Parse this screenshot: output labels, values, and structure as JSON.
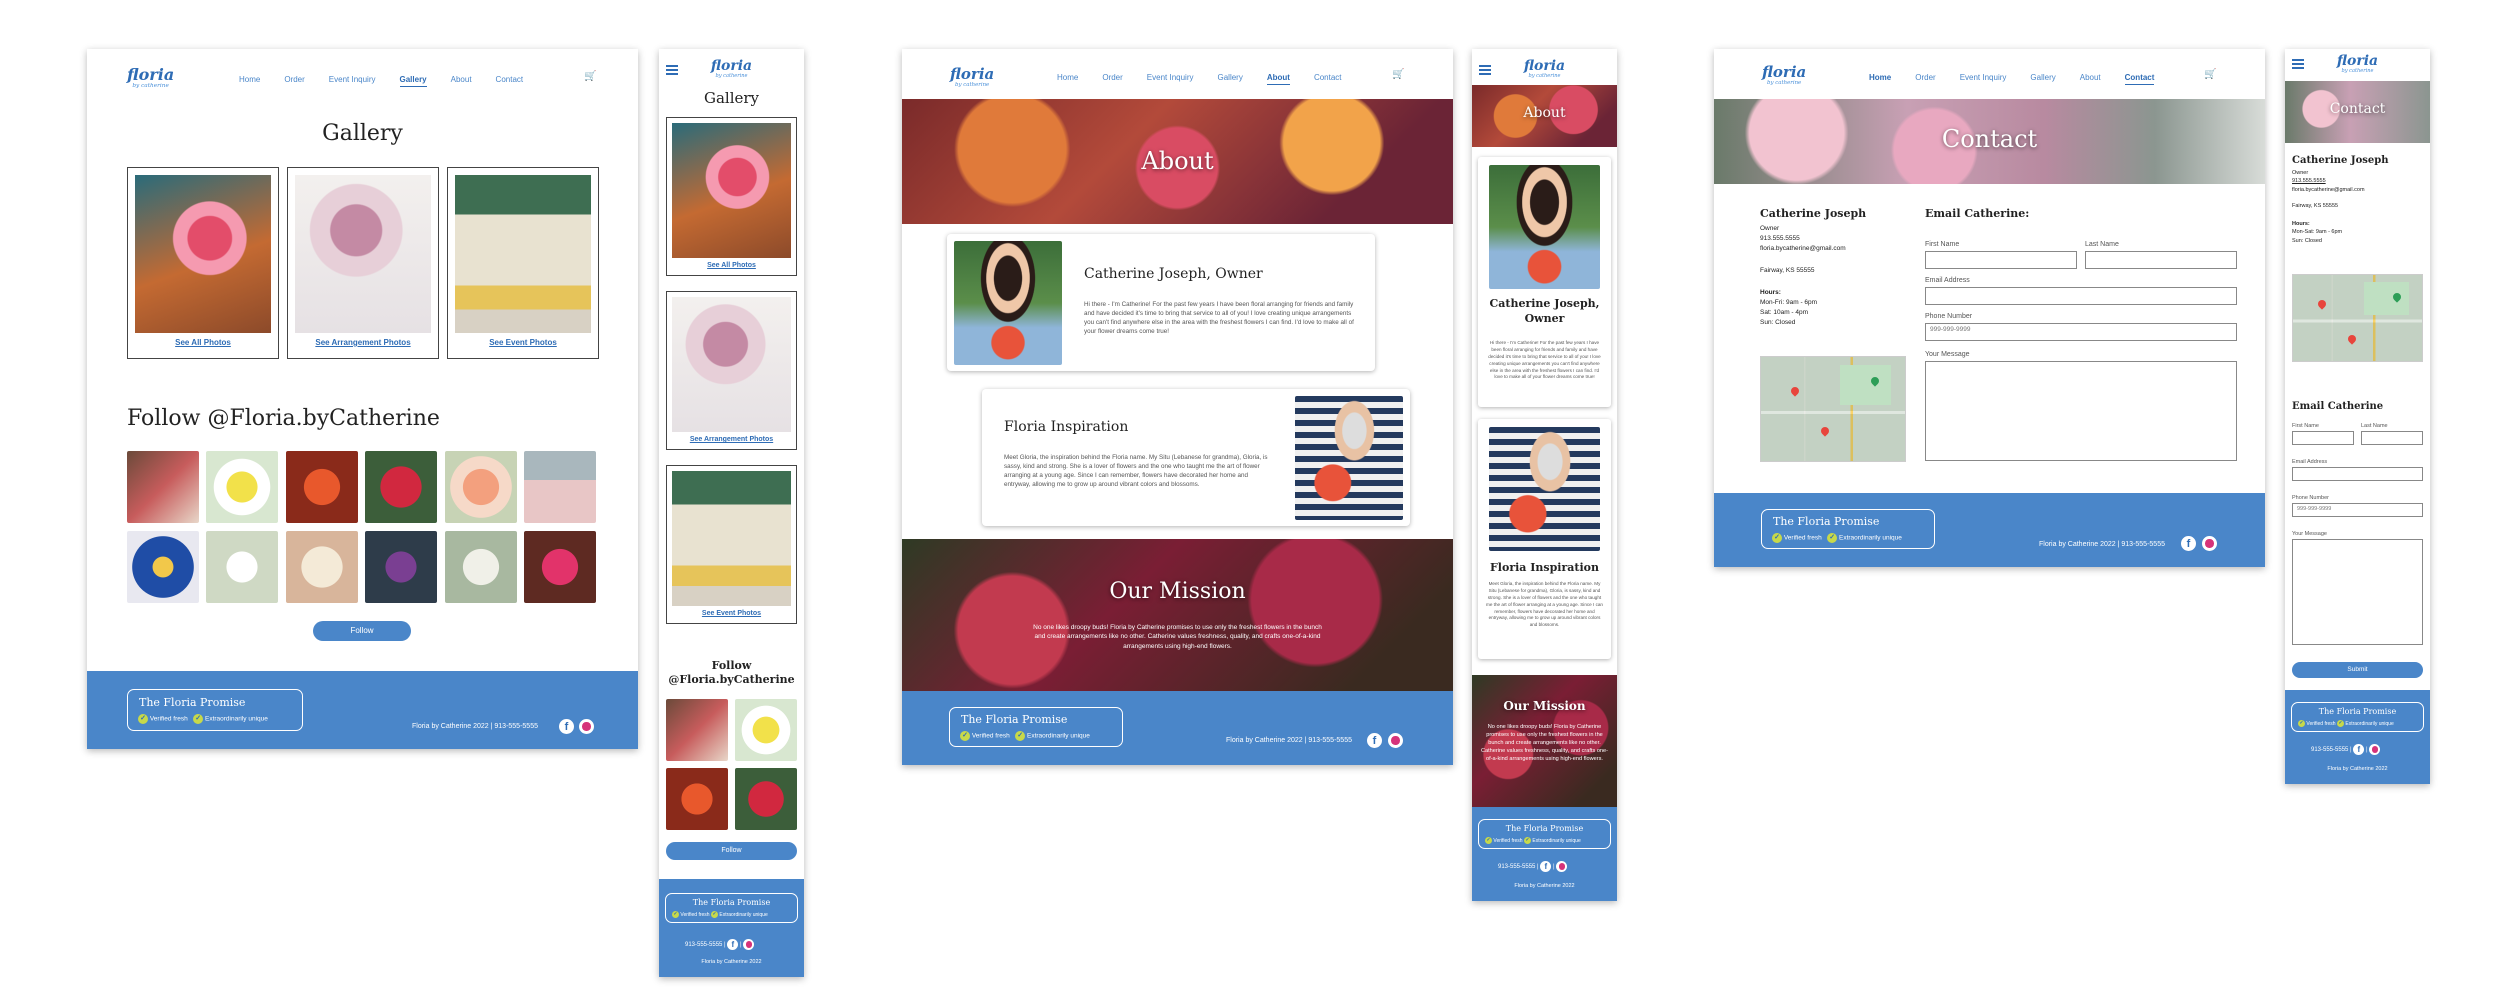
{
  "brand": {
    "logo": "floria",
    "tagline": "by catherine"
  },
  "nav": {
    "home": "Home",
    "order": "Order",
    "event": "Event Inquiry",
    "gallery": "Gallery",
    "about": "About",
    "contact": "Contact"
  },
  "gallery": {
    "title": "Gallery",
    "all": "See All Photos",
    "arr": "See Arrangement Photos",
    "evt": "See Event Photos",
    "follow_title": "Follow @Floria.byCatherine",
    "follow_mobile": "Follow @Floria.byCatherine",
    "follow_btn": "Follow"
  },
  "footer": {
    "promise": "The Floria Promise",
    "fresh": "Verified fresh",
    "unique": "Extraordinarily unique",
    "copy": "Floria by Catherine 2022",
    "phone": "913-555-5555",
    "sep": "|"
  },
  "about": {
    "title": "About",
    "owner_title": "Catherine Joseph, Owner",
    "owner_title_mobile": "Catherine Joseph, Owner",
    "owner_text": "Hi there - I'm Catherine! For the past few years I have been floral arranging for friends and family and have decided it's time to bring that service to all of you! I love creating unique arrangements you can't find anywhere else in the area with the freshest flowers I can find. I'd love to make all of your flower dreams come true!",
    "insp_title": "Floria Inspiration",
    "insp_text": "Meet Gloria, the inspiration behind the Floria name. My Situ (Lebanese for grandma), Gloria, is sassy, kind and strong. She is a lover of flowers and the one who taught me the art of flower arranging at a young age. Since I can remember, flowers have decorated her home and entryway, allowing me to grow up around vibrant colors and blossoms.",
    "mission_title": "Our Mission",
    "mission_text": "No one likes droopy buds! Floria by Catherine promises to use only the freshest flowers in the bunch and create arrangements like no other. Catherine values freshness, quality, and crafts one-of-a-kind arrangements using high-end flowers."
  },
  "contact": {
    "title": "Contact",
    "name": "Catherine Joseph",
    "role": "Owner",
    "phone": "913.555.5555",
    "email": "floria.bycatherine@gmail.com",
    "city": "Fairway, KS 55555",
    "hours_h": "Hours:",
    "hours1": "Mon-Fri: 9am - 6pm",
    "hours2": "Sat: 10am - 4pm",
    "hours3": "Sun: Closed",
    "hours_m1": "Mon-Sat: 9am - 6pm",
    "hours_m2": "Sun: Closed",
    "form_title": "Email Catherine:",
    "form_title_m": "Email Catherine",
    "first": "First Name",
    "last": "Last Name",
    "emailaddr": "Email Address",
    "phonenum": "Phone Number",
    "phone_ph": "999-999-9999",
    "message": "Your Message",
    "submit": "Submit"
  },
  "colors": {
    "primary": "#4a86c9",
    "accent": "#2e6cb5",
    "check": "#c7d94a"
  }
}
